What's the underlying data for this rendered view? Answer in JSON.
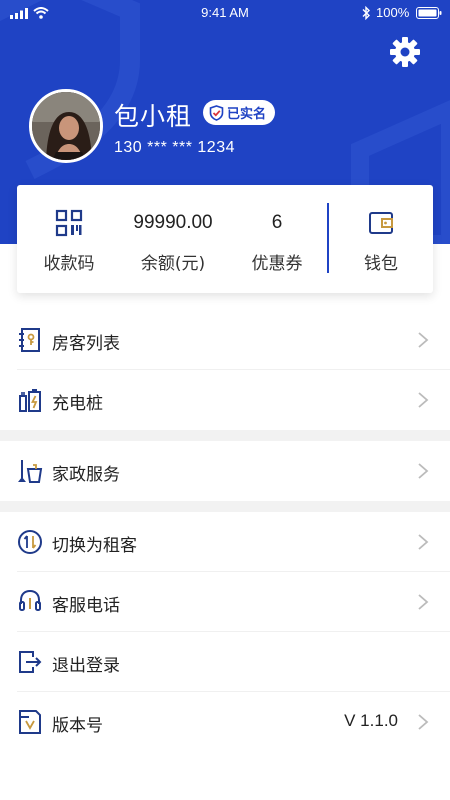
{
  "status_bar": {
    "time": "9:41 AM",
    "battery": "100%"
  },
  "header": {
    "name": "包小租",
    "verified_label": "已实名",
    "phone": "130 *** *** 1234",
    "colors": {
      "brand_blue": "#1f43c4"
    }
  },
  "summary": {
    "qr_label": "收款码",
    "balance_value": "99990.00",
    "balance_label": "余额(元)",
    "coupon_value": "6",
    "coupon_label": "优惠券",
    "wallet_label": "钱包"
  },
  "menu": {
    "tenants": "房客列表",
    "charging": "充电桩",
    "housekeeping": "家政服务",
    "switch_tenant": "切换为租客",
    "support_phone": "客服电话",
    "logout": "退出登录",
    "version_label": "版本号",
    "version_value": "V 1.1.0"
  }
}
